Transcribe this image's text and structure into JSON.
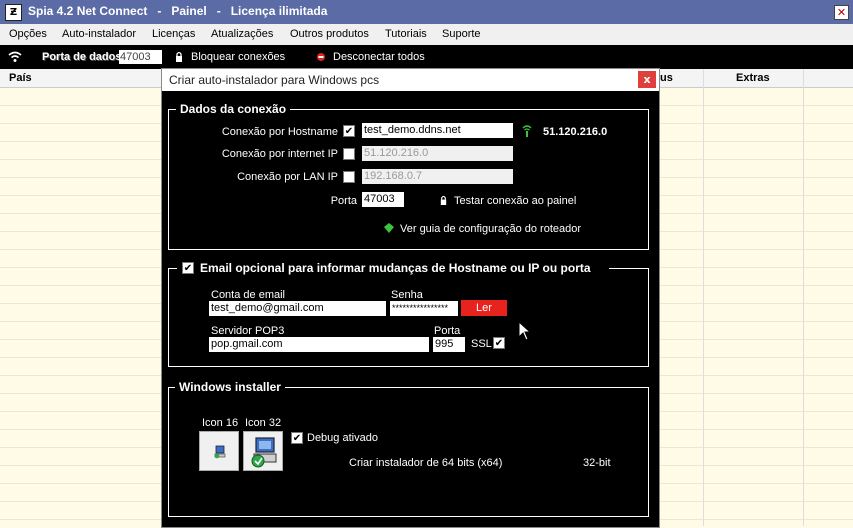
{
  "window": {
    "title": "Spia 4.2 Net Connect   -   Painel   -   Licença ilimitada",
    "app_icon": "spia-logo-icon",
    "close_glyph": "✕"
  },
  "menu": [
    "Opções",
    "Auto-instalador",
    "Licenças",
    "Atualizações",
    "Outros produtos",
    "Tutoriais",
    "Suporte"
  ],
  "toolbar": {
    "port_label": "Porta de dados:",
    "port_value": "47003",
    "block_label": "Bloquear conexões",
    "disconnect_label": "Desconectar todos"
  },
  "grid": {
    "columns": [
      "País",
      "us",
      "Extras"
    ]
  },
  "dialog": {
    "title": "Criar auto-instalador para Windows pcs",
    "close": "x",
    "connection": {
      "legend": "Dados da conexão",
      "hostname_label": "Conexão por Hostname",
      "hostname_value": "test_demo.ddns.net",
      "hostname_checked": true,
      "resolved_ip": "51.120.216.0",
      "internet_ip_label": "Conexão por internet IP",
      "internet_ip_value": "51.120.216.0",
      "lan_ip_label": "Conexão por LAN IP",
      "lan_ip_value": "192.168.0.7",
      "port_label": "Porta",
      "port_value": "47003",
      "test_label": "Testar conexão ao painel",
      "router_guide_label": "Ver guia de configuração do roteador"
    },
    "email": {
      "legend": "Email opcional para informar mudanças de Hostname ou IP ou porta",
      "enabled": true,
      "account_label": "Conta de email",
      "account_value": "test_demo@gmail.com",
      "password_label": "Senha",
      "password_value": "****************",
      "read_button": "Ler",
      "pop3_label": "Servidor POP3",
      "pop3_value": "pop.gmail.com",
      "port_label": "Porta",
      "port_value": "995",
      "ssl_label": "SSL",
      "ssl_checked": true
    },
    "installer": {
      "legend": "Windows installer",
      "icon16_label": "Icon 16",
      "icon32_label": "Icon 32",
      "debug_label": "Debug ativado",
      "debug_checked": true,
      "build64_label": "Criar instalador de 64 bits  (x64)",
      "build32_label": "32-bit"
    }
  },
  "colors": {
    "titlebar": "#5b6ba6",
    "dialog_bg": "#000000",
    "accent_red": "#e8231e",
    "status_green": "#3cc43c",
    "grid_bg": "#fffbe6"
  }
}
